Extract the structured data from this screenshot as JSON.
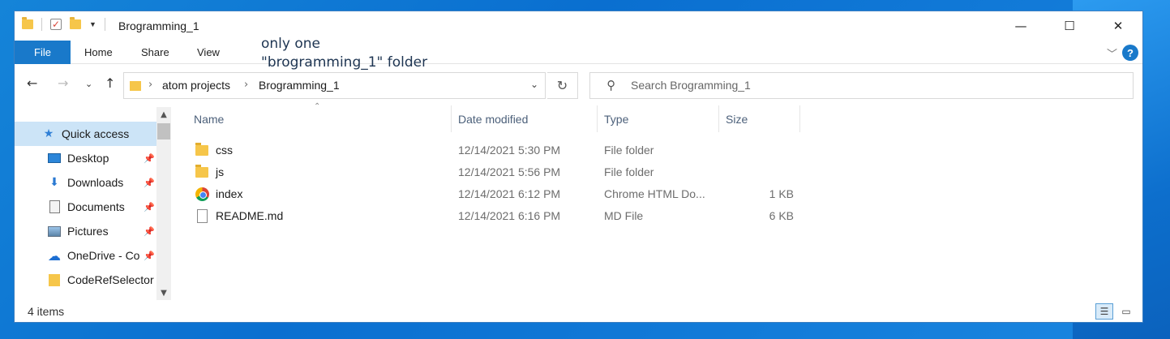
{
  "window": {
    "title": "Brogramming_1",
    "controls": {
      "minimize": "—",
      "maximize": "☐",
      "close": "✕"
    }
  },
  "ribbon": {
    "tabs": [
      "File",
      "Home",
      "Share",
      "View"
    ],
    "annotation": "only one\n\"brogramming_1\" folder"
  },
  "address": {
    "breadcrumb": [
      "atom projects",
      "Brogramming_1"
    ]
  },
  "search": {
    "placeholder": "Search Brogramming_1"
  },
  "nav_pane": {
    "items": [
      {
        "label": "Quick access",
        "icon": "star-icon",
        "pinned": false
      },
      {
        "label": "Desktop",
        "icon": "desktop-icon",
        "pinned": true
      },
      {
        "label": "Downloads",
        "icon": "download-icon",
        "pinned": true
      },
      {
        "label": "Documents",
        "icon": "documents-icon",
        "pinned": true
      },
      {
        "label": "Pictures",
        "icon": "pictures-icon",
        "pinned": true
      },
      {
        "label": "OneDrive - Co",
        "icon": "onedrive-icon",
        "pinned": true
      },
      {
        "label": "CodeRefSelector",
        "icon": "folder-icon",
        "pinned": false
      }
    ]
  },
  "file_list": {
    "columns": [
      "Name",
      "Date modified",
      "Type",
      "Size"
    ],
    "rows": [
      {
        "name": "css",
        "date": "12/14/2021 5:30 PM",
        "type": "File folder",
        "size": "",
        "icon": "folder-icon"
      },
      {
        "name": "js",
        "date": "12/14/2021 5:56 PM",
        "type": "File folder",
        "size": "",
        "icon": "folder-icon"
      },
      {
        "name": "index",
        "date": "12/14/2021 6:12 PM",
        "type": "Chrome HTML Do...",
        "size": "1 KB",
        "icon": "chrome-icon"
      },
      {
        "name": "README.md",
        "date": "12/14/2021 6:16 PM",
        "type": "MD File",
        "size": "6 KB",
        "icon": "file-icon"
      }
    ]
  },
  "status_bar": {
    "item_count": "4 items"
  },
  "colors": {
    "accent": "#1979ca",
    "selection": "#cce4f7",
    "desktop": "#0a6fd0"
  }
}
